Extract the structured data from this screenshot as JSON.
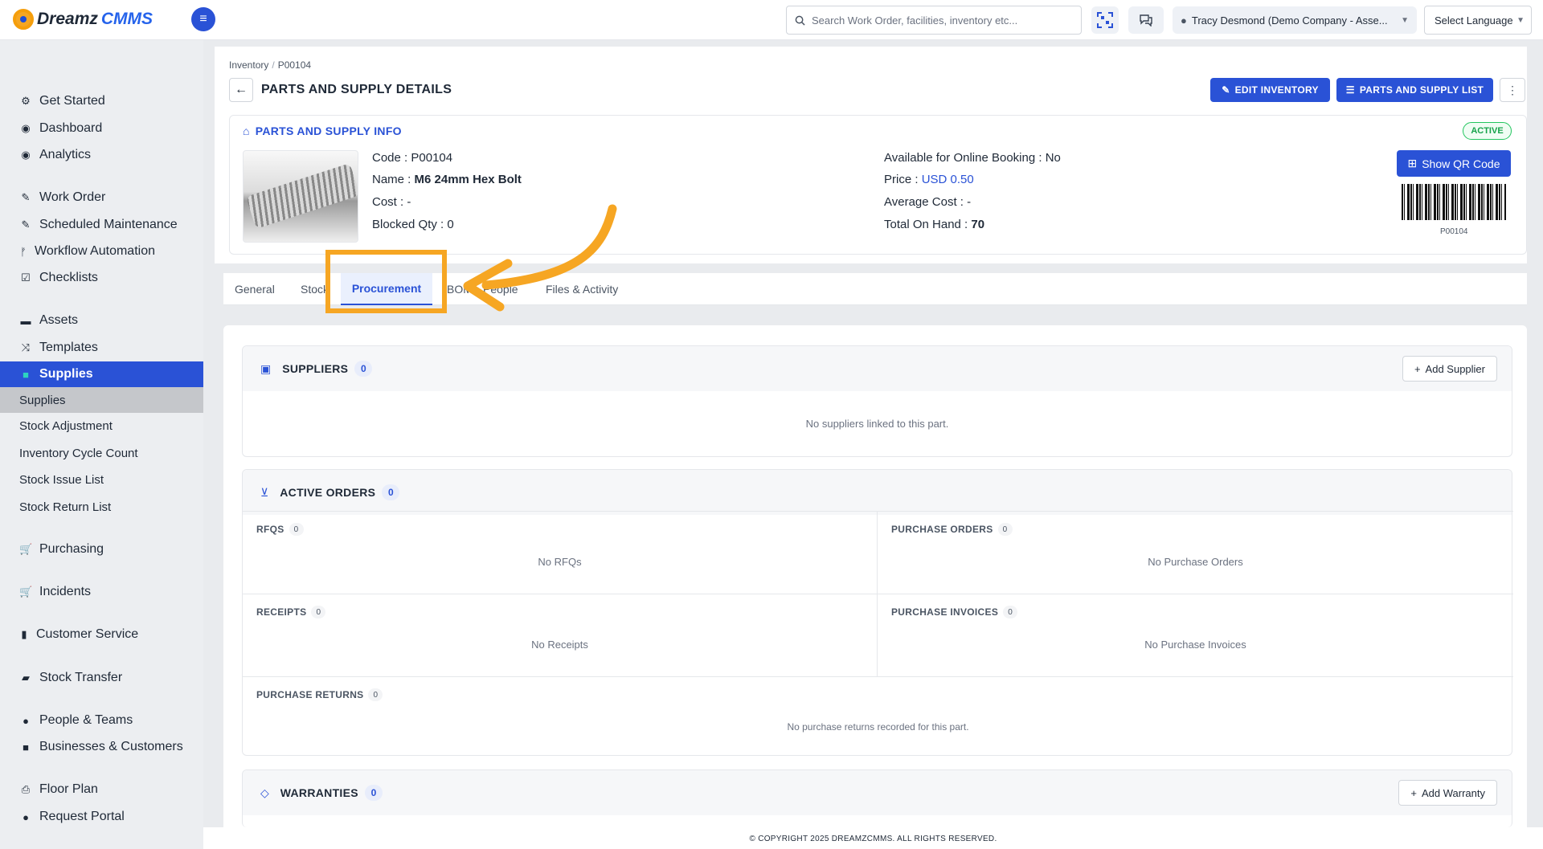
{
  "app": {
    "brand_part1": "Dreamz",
    "brand_part2": "CMMS"
  },
  "header": {
    "search_placeholder": "Search Work Order, facilities, inventory etc...",
    "user_label": "Tracy Desmond (Demo Company - Asse...",
    "language_label": "Select Language"
  },
  "sidebar": {
    "items": [
      {
        "label": "Get Started",
        "icon": "gears-icon"
      },
      {
        "label": "Dashboard",
        "icon": "dashboard-icon"
      },
      {
        "label": "Analytics",
        "icon": "analytics-icon"
      },
      {
        "label": "Work Order",
        "icon": "wrench-icon"
      },
      {
        "label": "Scheduled Maintenance",
        "icon": "wrench-icon"
      },
      {
        "label": "Workflow Automation",
        "icon": "branch-icon"
      },
      {
        "label": "Checklists",
        "icon": "checkbox-icon"
      },
      {
        "label": "Assets",
        "icon": "archive-icon"
      },
      {
        "label": "Templates",
        "icon": "shuffle-icon"
      },
      {
        "label": "Supplies",
        "icon": "box-icon"
      },
      {
        "label": "Supplies"
      },
      {
        "label": "Stock Adjustment"
      },
      {
        "label": "Inventory Cycle Count"
      },
      {
        "label": "Stock Issue List"
      },
      {
        "label": "Stock Return List"
      },
      {
        "label": "Purchasing",
        "icon": "cart-icon"
      },
      {
        "label": "Incidents",
        "icon": "cart-icon"
      },
      {
        "label": "Customer Service",
        "icon": "file-icon"
      },
      {
        "label": "Stock Transfer",
        "icon": "truck-icon"
      },
      {
        "label": "People & Teams",
        "icon": "users-icon"
      },
      {
        "label": "Businesses & Customers",
        "icon": "video-icon"
      },
      {
        "label": "Floor Plan",
        "icon": "print-icon"
      },
      {
        "label": "Request Portal",
        "icon": "chat-icon"
      }
    ]
  },
  "breadcrumb": {
    "parent": "Inventory",
    "sep": "/",
    "current": "P00104"
  },
  "page": {
    "title": "PARTS AND SUPPLY DETAILS",
    "edit_button": "EDIT INVENTORY",
    "list_button": "PARTS AND SUPPLY LIST"
  },
  "info": {
    "section_title": "PARTS AND SUPPLY INFO",
    "status": "ACTIVE",
    "code_label": "Code :",
    "code_value": "P00104",
    "name_label": "Name :",
    "name_value": "M6 24mm Hex Bolt",
    "cost_label": "Cost :",
    "cost_value": "-",
    "blocked_label": "Blocked Qty :",
    "blocked_value": "0",
    "online_label": "Available for Online Booking :",
    "online_value": "No",
    "price_label": "Price :",
    "price_value": "USD 0.50",
    "avg_cost_label": "Average Cost :",
    "avg_cost_value": "-",
    "on_hand_label": "Total On Hand :",
    "on_hand_value": "70",
    "qr_button": "Show QR Code",
    "barcode_label": "P00104"
  },
  "tabs": [
    {
      "label": "General"
    },
    {
      "label": "Stock"
    },
    {
      "label": "Procurement"
    },
    {
      "label": "BOM"
    },
    {
      "label": "People"
    },
    {
      "label": "Files & Activity"
    }
  ],
  "suppliers": {
    "title": "SUPPLIERS",
    "count": "0",
    "add_button": "Add Supplier",
    "empty": "No suppliers linked to this part."
  },
  "orders": {
    "title": "ACTIVE ORDERS",
    "count": "0",
    "rfqs": {
      "label": "RFQS",
      "count": "0",
      "empty": "No RFQs"
    },
    "purchase_orders": {
      "label": "PURCHASE ORDERS",
      "count": "0",
      "empty": "No Purchase Orders"
    },
    "receipts": {
      "label": "RECEIPTS",
      "count": "0",
      "empty": "No Receipts"
    },
    "purchase_invoices": {
      "label": "PURCHASE INVOICES",
      "count": "0",
      "empty": "No Purchase Invoices"
    },
    "purchase_returns": {
      "label": "PURCHASE RETURNS",
      "count": "0",
      "empty": "No purchase returns recorded for this part."
    }
  },
  "warranties": {
    "title": "WARRANTIES",
    "count": "0",
    "add_button": "Add Warranty"
  },
  "footer": {
    "text": "© COPYRIGHT 2025 DREAMZCMMS. ALL RIGHTS RESERVED."
  },
  "colors": {
    "primary": "#2a52d6",
    "annotation": "#f6a623",
    "active_badge": "#16a34a"
  }
}
